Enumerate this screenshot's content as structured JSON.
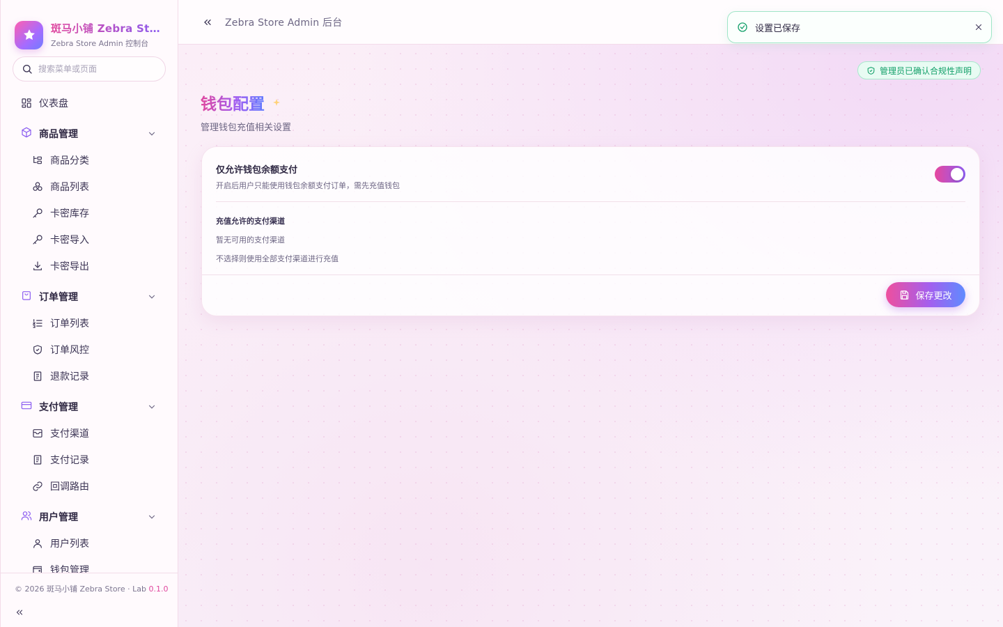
{
  "brand": {
    "title": "斑马小铺 Zebra Store",
    "subtitle": "Zebra Store Admin 控制台"
  },
  "search": {
    "placeholder": "搜索菜单或页面"
  },
  "menu": {
    "dashboard": "仪表盘",
    "products": {
      "label": "商品管理",
      "items": [
        "商品分类",
        "商品列表",
        "卡密库存",
        "卡密导入",
        "卡密导出"
      ]
    },
    "orders": {
      "label": "订单管理",
      "items": [
        "订单列表",
        "订单风控",
        "退款记录"
      ]
    },
    "payments": {
      "label": "支付管理",
      "items": [
        "支付渠道",
        "支付记录",
        "回调路由"
      ]
    },
    "users": {
      "label": "用户管理",
      "items": [
        "用户列表",
        "钱包管理"
      ]
    }
  },
  "footer": {
    "copyright": "© 2026 斑马小铺 Zebra Store · Lab ",
    "version": "0.1.0"
  },
  "topbar": {
    "title": "Zebra Store Admin 后台"
  },
  "toast": {
    "message": "设置已保存"
  },
  "compliance": {
    "label": "管理员已确认合规性声明"
  },
  "page": {
    "title": "钱包配置",
    "subtitle": "管理钱包充值相关设置"
  },
  "settings": {
    "wallet_only": {
      "title": "仅允许钱包余额支付",
      "description": "开启后用户只能使用钱包余额支付订单，需先充值钱包",
      "enabled": true
    },
    "channels": {
      "label": "充值允许的支付渠道",
      "empty": "暂无可用的支付渠道",
      "hint": "不选择则使用全部支付渠道进行充值"
    },
    "save_label": "保存更改"
  },
  "colors": {
    "accent_pink": "#e0479e",
    "accent_purple": "#8f5df2",
    "accent_blue": "#5f7bff",
    "success": "#14a06a"
  }
}
